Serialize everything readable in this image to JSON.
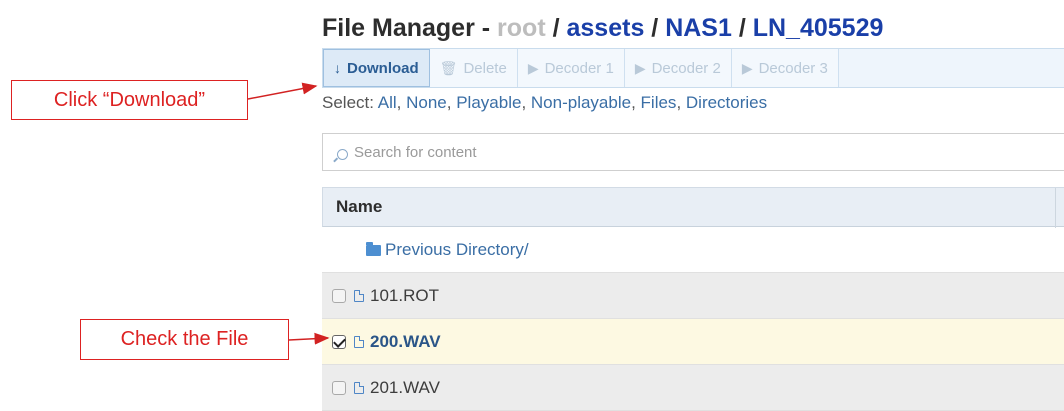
{
  "header": {
    "title_prefix": "File Manager - ",
    "breadcrumb": [
      {
        "label": "root",
        "style": "muted"
      },
      {
        "label": " / ",
        "style": "sep"
      },
      {
        "label": "assets",
        "style": "link"
      },
      {
        "label": " / ",
        "style": "sep"
      },
      {
        "label": "NAS1",
        "style": "link"
      },
      {
        "label": " / ",
        "style": "sep"
      },
      {
        "label": "LN_405529",
        "style": "link"
      }
    ]
  },
  "toolbar": {
    "download": "Download",
    "delete": "Delete",
    "decoder1": "Decoder 1",
    "decoder2": "Decoder 2",
    "decoder3": "Decoder 3"
  },
  "select": {
    "label": "Select: ",
    "options": [
      "All",
      "None",
      "Playable",
      "Non-playable",
      "Files",
      "Directories"
    ]
  },
  "search": {
    "placeholder": "Search for content"
  },
  "table": {
    "header_name": "Name",
    "prev_dir": "Previous Directory/",
    "files": [
      {
        "name": "101.ROT",
        "checked": false
      },
      {
        "name": "200.WAV",
        "checked": true
      },
      {
        "name": "201.WAV",
        "checked": false
      }
    ]
  },
  "annotations": {
    "download_callout": "Click “Download”",
    "check_callout": "Check the File",
    "color": "#d22222"
  },
  "icons": {
    "download": "download-arrow-icon",
    "delete": "trash-icon",
    "decoder": "play-triangle-icon",
    "search": "search-icon",
    "folder": "folder-icon",
    "file": "file-icon"
  }
}
